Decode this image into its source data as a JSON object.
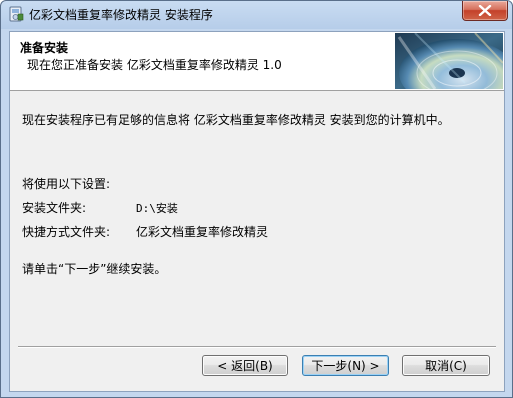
{
  "window": {
    "title": "亿彩文档重复率修改精灵 安装程序"
  },
  "header": {
    "title": "准备安装",
    "subtitle": "现在您正准备安装 亿彩文档重复率修改精灵 1.0"
  },
  "body": {
    "intro": "现在安装程序已有足够的信息将 亿彩文档重复率修改精灵 安装到您的计算机中。",
    "settings_heading": "将使用以下设置:",
    "install_folder_label": "安装文件夹:",
    "install_folder_value": "D:\\安装",
    "shortcut_folder_label": "快捷方式文件夹:",
    "shortcut_folder_value": "亿彩文档重复率修改精灵",
    "next_hint": "请单击“下一步”继续安装。"
  },
  "buttons": {
    "back": "< 返回(B)",
    "next": "下一步(N) >",
    "cancel": "取消(C)"
  },
  "icons": {
    "app": "installer-icon",
    "close": "close-icon",
    "header_image": "cd-disc-image"
  },
  "colors": {
    "close_button": "#c4412a",
    "default_button_border": "#3c7fb1"
  }
}
